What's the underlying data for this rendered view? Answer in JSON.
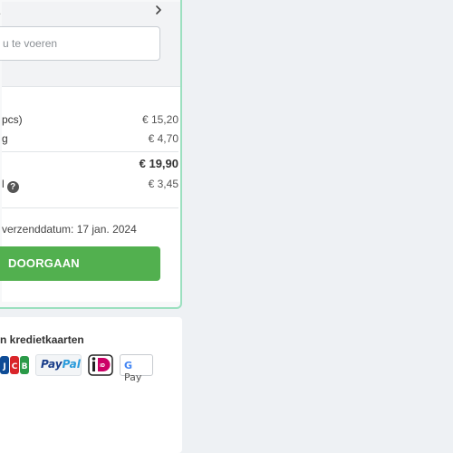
{
  "coupon": {
    "title_fragment": "e",
    "input_placeholder_fragment": "u te voeren"
  },
  "summary": {
    "rows": [
      {
        "label": " pcs)",
        "value": "€ 15,20"
      },
      {
        "label": "g",
        "value": "€ 4,70"
      }
    ],
    "total": {
      "label": "",
      "value": "€ 19,90"
    },
    "extra": {
      "label": "l",
      "value": "€ 3,45"
    },
    "help_glyph": "?"
  },
  "shipping": {
    "text": "verzenddatum: 17 jan. 2024"
  },
  "cta": {
    "label": "DOORGAAN"
  },
  "payments": {
    "title": "n kredietkaarten",
    "logos": [
      {
        "name": "JCB",
        "icon": "jcb-logo"
      },
      {
        "name": "PayPal",
        "icon": "paypal-logo",
        "text_a": "Pay",
        "text_b": "Pal"
      },
      {
        "name": "iDEAL",
        "icon": "ideal-logo"
      },
      {
        "name": "Google Pay",
        "icon": "gpay-logo",
        "text_a": "G",
        "text_b": "Pay"
      }
    ]
  },
  "colors": {
    "accent_border": "#9be0bf",
    "cta_green": "#52b04f",
    "page_bg": "#eef1f4"
  }
}
